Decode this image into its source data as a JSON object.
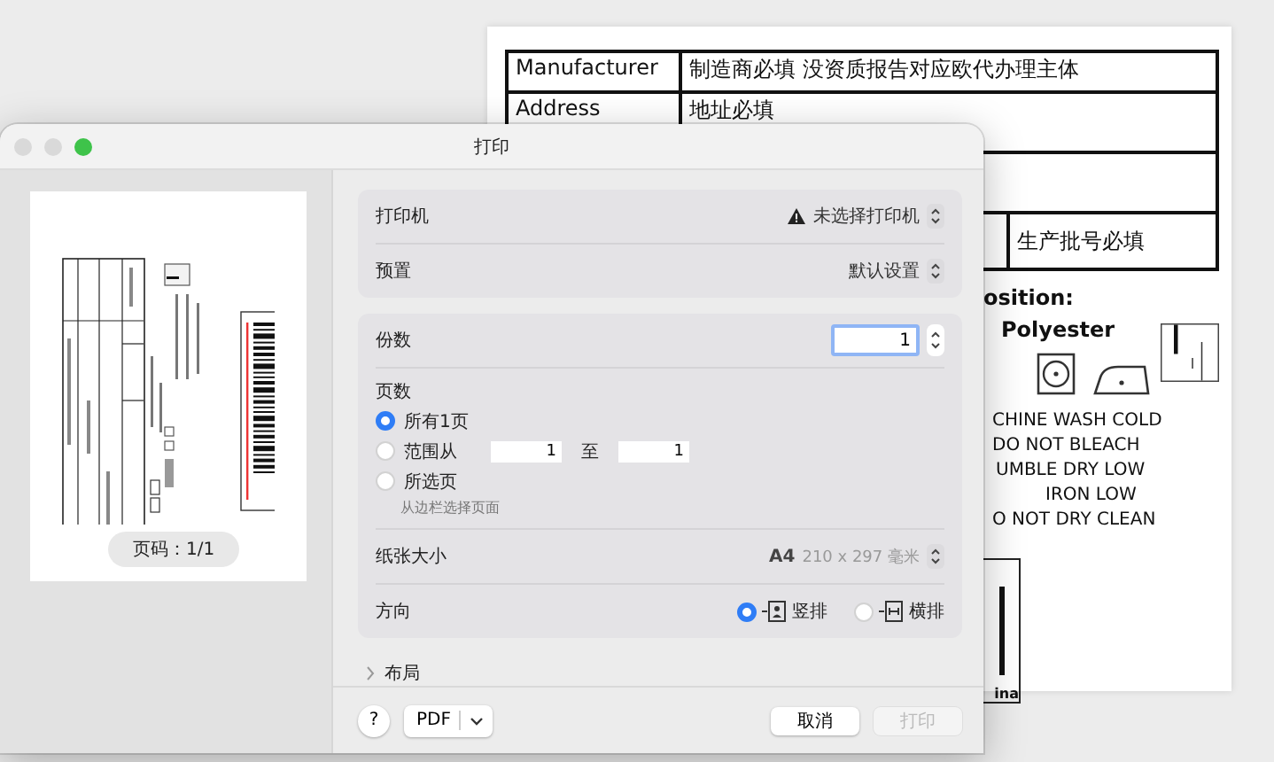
{
  "background_document": {
    "table_rows": [
      {
        "label": "Manufacturer",
        "value": "制造商必填 没资质报告对应欧代办理主体"
      },
      {
        "label": "Address",
        "value": "地址必填"
      },
      {
        "value": "生产批号必填"
      }
    ],
    "composition_heading": "osition:",
    "composition_value": "Polyester",
    "care_lines": [
      "CHINE WASH COLD",
      "DO NOT BLEACH",
      "UMBLE DRY LOW",
      "IRON LOW",
      "O NOT DRY CLEAN"
    ],
    "origin_label": "ina"
  },
  "dialog": {
    "title": "打印",
    "window_buttons": [
      {
        "color": "#d9d9d9"
      },
      {
        "color": "#d9d9d9"
      },
      {
        "color": "#3ec34a"
      }
    ],
    "preview": {
      "page_label": "页码：1/1"
    },
    "printer": {
      "label": "打印机",
      "value": "未选择打印机",
      "warning": true
    },
    "preset": {
      "label": "预置",
      "value": "默认设置"
    },
    "copies": {
      "label": "份数",
      "value": "1"
    },
    "pages": {
      "label": "页数",
      "options": [
        {
          "kind": "all",
          "label": "所有1页",
          "selected": true
        },
        {
          "kind": "range",
          "label": "范围从",
          "selected": false,
          "from": "1",
          "to_label": "至",
          "to": "1"
        },
        {
          "kind": "selection",
          "label": "所选页",
          "selected": false,
          "hint": "从边栏选择页面"
        }
      ]
    },
    "paper": {
      "label": "纸张大小",
      "size": "A4",
      "dimensions": "210 x 297 毫米"
    },
    "orientation": {
      "label": "方向",
      "options": [
        {
          "kind": "portrait",
          "label": "竖排",
          "selected": true
        },
        {
          "kind": "landscape",
          "label": "横排",
          "selected": false
        }
      ]
    },
    "layout": {
      "label": "布局",
      "expanded": false
    },
    "footer": {
      "help": "?",
      "pdf": "PDF",
      "cancel": "取消",
      "print": {
        "label": "打印",
        "disabled": true
      }
    }
  }
}
